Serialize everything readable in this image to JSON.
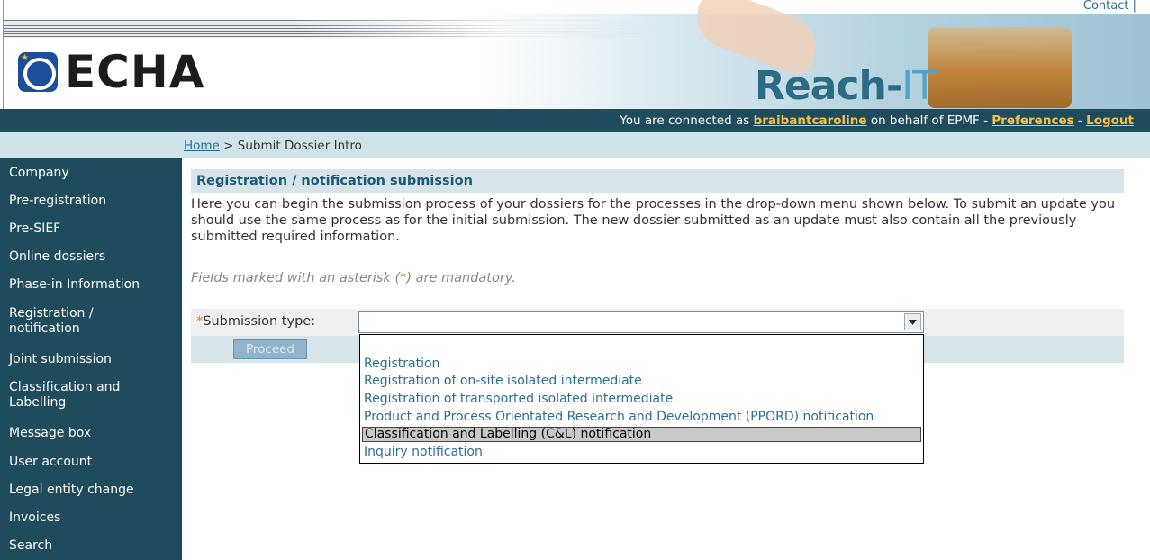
{
  "header": {
    "contact_label": "Contact",
    "contact_sep": "|",
    "logo_text": "ECHA",
    "app_title_main": "Reach-",
    "app_title_suffix": "IT"
  },
  "status": {
    "prefix": "You are connected as ",
    "username": "braibantcaroline",
    "middle": " on behalf of EPMF - ",
    "preferences": "Preferences",
    "dash": " - ",
    "logout": "Logout"
  },
  "breadcrumb": {
    "home": "Home",
    "sep": " > ",
    "current": "Submit Dossier Intro"
  },
  "sidebar": {
    "items": [
      {
        "label": "Company"
      },
      {
        "label": "Pre-registration"
      },
      {
        "label": "Pre-SIEF"
      },
      {
        "label": "Online dossiers"
      },
      {
        "label": "Phase-in Information"
      },
      {
        "label": "Registration /\nnotification"
      },
      {
        "label": "Joint submission"
      },
      {
        "label": "Classification and\nLabelling"
      },
      {
        "label": "Message box"
      },
      {
        "label": "User account"
      },
      {
        "label": "Legal entity change"
      },
      {
        "label": "Invoices"
      },
      {
        "label": "Search"
      }
    ]
  },
  "main": {
    "section_title": "Registration / notification submission",
    "intro": "Here you can begin the submission process of your dossiers for the processes in the drop-down menu shown below. To submit an update you should use the same process as for the initial submission. The new dossier submitted as an update must also contain all the previously submitted required information.",
    "mandatory_prefix": "Fields marked with an asterisk (",
    "mandatory_ast": "*",
    "mandatory_suffix": ") are mandatory.",
    "submission_label": "Submission type:",
    "submission_ast": "*",
    "submission_value": "",
    "proceed_label": "Proceed"
  },
  "dropdown": {
    "options": [
      "",
      "Registration",
      "Registration of on-site isolated intermediate",
      "Registration of transported isolated intermediate",
      "Product and Process Orientated Research and Development (PPORD) notification",
      "Classification and Labelling (C&L) notification",
      "Inquiry notification"
    ],
    "highlighted_index": 5
  },
  "colors": {
    "nav_bg": "#1f4c5c",
    "link": "#2a6f92",
    "accent_orange": "#f07d1b",
    "status_link": "#f5c04a"
  }
}
